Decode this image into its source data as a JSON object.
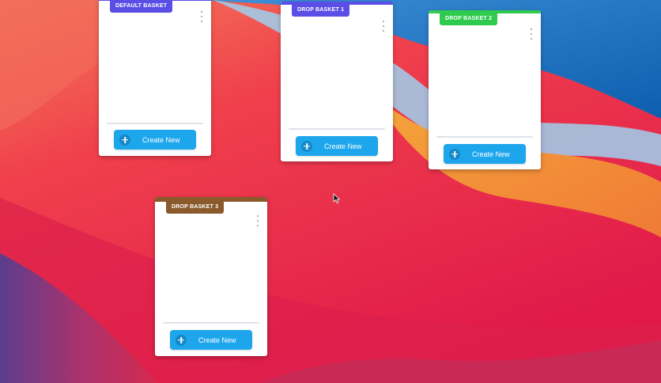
{
  "wallpaper": {
    "colors": {
      "blue": "#1f79c8",
      "light_blue": "#8fc9ec",
      "orange": "#f6a43a",
      "red": "#ee2f45",
      "pink": "#d0396b",
      "purple": "#6b3f8d"
    }
  },
  "baskets": [
    {
      "tag": "DEFAULT BASKET",
      "color": "#5b4ee6",
      "create_label": "Create New"
    },
    {
      "tag": "DROP BASKET 1",
      "color": "#5b4ee6",
      "create_label": "Create New"
    },
    {
      "tag": "DROP BASKET 2",
      "color": "#2fcb4f",
      "create_label": "Create New"
    },
    {
      "tag": "DROP BASKET 3",
      "color": "#8a5a2c",
      "create_label": "Create New"
    }
  ],
  "icons": {
    "menu": "kebab-icon",
    "add": "plus-icon",
    "pointer": "mouse-cursor-icon"
  }
}
